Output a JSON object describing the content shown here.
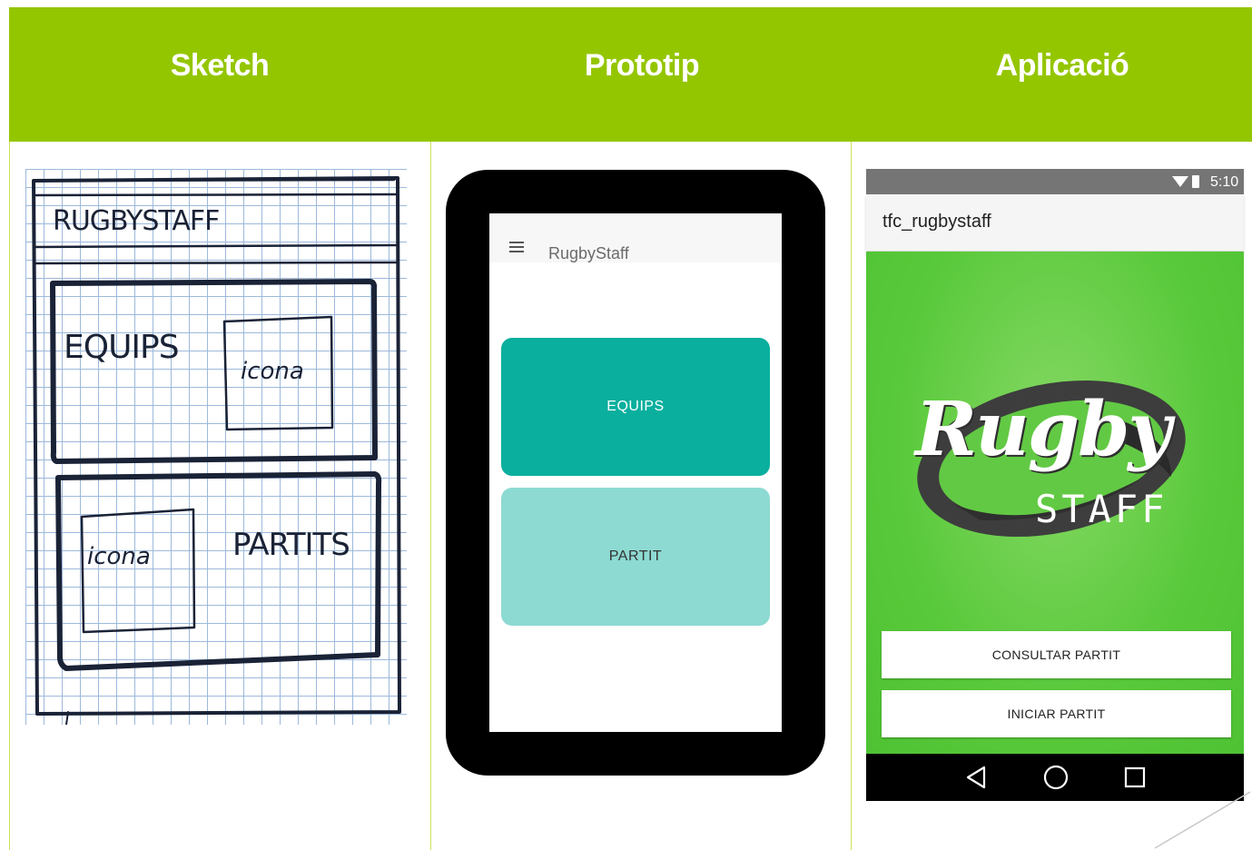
{
  "header": {
    "col1_title": "Sketch",
    "col2_title": "Prototip",
    "col3_title": "Aplicació"
  },
  "sketch": {
    "app_title": "RUGBYSTAFF",
    "block1_label": "EQUIPS",
    "block1_icon_label": "icona",
    "block2_label": "PARTITS",
    "block2_icon_label": "icona"
  },
  "prototype": {
    "app_title": "RugbyStaff",
    "menu_icon": "hamburger-menu-icon",
    "button1_label": "EQUIPS",
    "button2_label": "PARTIT",
    "colors": {
      "button1": "#0aaf9e",
      "button2": "#8ddad2"
    }
  },
  "app": {
    "status_time": "5:10",
    "app_title": "tfc_rugbystaff",
    "logo_word1": "Rugby",
    "logo_word2": "STAFF",
    "button1_label": "CONSULTAR PARTIT",
    "button2_label": "INICIAR PARTIT",
    "colors": {
      "background": "#58c93a",
      "status_bar": "#757575"
    }
  }
}
